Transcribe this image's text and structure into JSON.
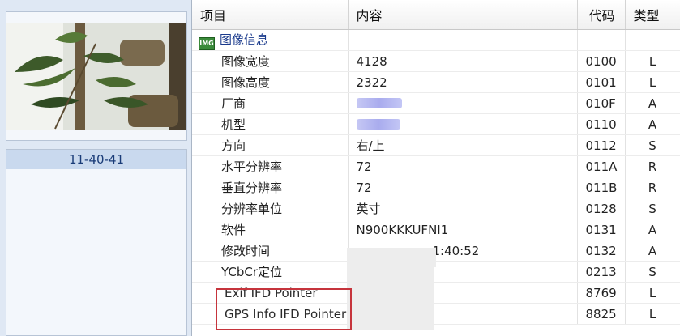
{
  "folder": {
    "selected": "11-40-41"
  },
  "columns": {
    "item": "项目",
    "content": "内容",
    "code": "代码",
    "type": "类型"
  },
  "group": {
    "icon_text": "IMG",
    "label": "图像信息"
  },
  "rows": [
    {
      "item": "图像宽度",
      "content": "4128",
      "code": "0100",
      "type": "L"
    },
    {
      "item": "图像高度",
      "content": "2322",
      "code": "0101",
      "type": "L"
    },
    {
      "item": "厂商",
      "content": "",
      "code": "010F",
      "type": "A"
    },
    {
      "item": "机型",
      "content": "",
      "code": "0110",
      "type": "A"
    },
    {
      "item": "方向",
      "content": "右/上",
      "code": "0112",
      "type": "S"
    },
    {
      "item": "水平分辨率",
      "content": "72",
      "code": "011A",
      "type": "R"
    },
    {
      "item": "垂直分辨率",
      "content": "72",
      "code": "011B",
      "type": "R"
    },
    {
      "item": "分辨率单位",
      "content": "英寸",
      "code": "0128",
      "type": "S"
    },
    {
      "item": "软件",
      "content": "N900KKKUFNI1",
      "code": "0131",
      "type": "A"
    },
    {
      "item": "修改时间",
      "content": "1:40:52",
      "code": "0132",
      "type": "A"
    },
    {
      "item": "YCbCr定位",
      "content": "",
      "code": "0213",
      "type": "S"
    },
    {
      "item": "Exif IFD Pointer",
      "content": "",
      "code": "8769",
      "type": "L"
    },
    {
      "item": "GPS Info IFD Pointer",
      "content": "",
      "code": "8825",
      "type": "L"
    }
  ]
}
